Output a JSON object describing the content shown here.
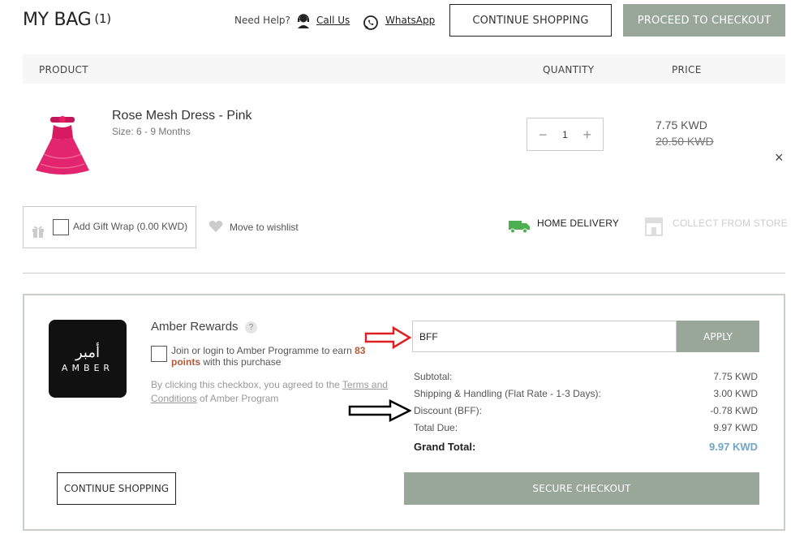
{
  "header": {
    "title": "MY BAG",
    "count": "(1)",
    "need_help": "Need Help?",
    "call_us": "Call Us",
    "whatsapp": "WhatsApp",
    "continue_shopping": "CONTINUE SHOPPING",
    "proceed_checkout": "PROCEED TO CHECKOUT"
  },
  "table": {
    "col_product": "PRODUCT",
    "col_quantity": "QUANTITY",
    "col_price": "PRICE"
  },
  "item": {
    "name": "Rose Mesh Dress - Pink",
    "size": "Size: 6 - 9 Months",
    "quantity": "1",
    "price": "7.75 KWD",
    "original_price": "20.50 KWD",
    "remove": "×",
    "gift_wrap": "Add Gift Wrap (0.00 KWD)",
    "wishlist": "Move to wishlist",
    "home_delivery": "HOME DELIVERY",
    "collect_store": "COLLECT FROM STORE"
  },
  "rewards": {
    "logo_ar": "أمبر",
    "logo_en": "AMBER",
    "title": "Amber Rewards",
    "help": "?",
    "join_prefix": "Join or login to Amber Programme to earn ",
    "points": "83 points",
    "join_suffix": " with this purchase",
    "agree_prefix": "By clicking this checkbox, you agreed to the ",
    "terms_link": "Terms and Conditions",
    "agree_suffix": " of Amber Program"
  },
  "coupon": {
    "value": "BFF",
    "apply": "APPLY"
  },
  "summary": {
    "subtotal_label": "Subtotal:",
    "subtotal": "7.75 KWD",
    "shipping_label": "Shipping & Handling (Flat Rate - 1-3 Days):",
    "shipping": "3.00 KWD",
    "discount_label": "Discount (BFF):",
    "discount": "-0.78 KWD",
    "total_due_label": "Total Due:",
    "total_due": "9.97 KWD",
    "grand_label": "Grand Total:",
    "grand_total": "9.97 KWD"
  },
  "footer": {
    "continue_shopping": "CONTINUE SHOPPING",
    "secure_checkout": "SECURE CHECKOUT"
  },
  "colors": {
    "accent_green": "#98a79a",
    "grand_total_blue": "#6fa6c4",
    "points_orange": "#b05a37",
    "annotation_red": "#e02020",
    "annotation_black": "#000000"
  }
}
